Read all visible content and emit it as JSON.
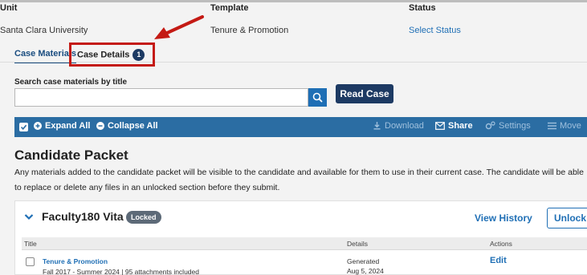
{
  "header": {
    "unit_label": "Unit",
    "unit_value": "Santa Clara University",
    "template_label": "Template",
    "template_value": "Tenure & Promotion",
    "status_label": "Status",
    "status_value": "Select Status"
  },
  "tabs": [
    {
      "label": "Case Materials"
    },
    {
      "label": "Case Details",
      "badge": "1"
    }
  ],
  "search": {
    "label": "Search case materials by title",
    "placeholder": "",
    "read_case_label": "Read Case"
  },
  "toolbar": {
    "expand_all": "Expand All",
    "collapse_all": "Collapse All",
    "download": "Download",
    "share": "Share",
    "settings": "Settings",
    "move": "Move"
  },
  "packet": {
    "title": "Candidate Packet",
    "description": "Any materials added to the candidate packet will be visible to the candidate and available for them to use in their current case. The candidate will be able to replace or delete any files in an unlocked section before they submit."
  },
  "section": {
    "title": "Faculty180 Vita",
    "locked_badge": "Locked",
    "view_history": "View History",
    "unlock": "Unlock",
    "columns": [
      "Title",
      "Details",
      "Actions"
    ],
    "rows": [
      {
        "title": "Tenure & Promotion",
        "subtitle": "Fall 2017 - Summer 2024 | 95 attachments included",
        "details_1": "Generated",
        "details_2": "Aug 5, 2024",
        "action": "Edit"
      }
    ]
  },
  "colors": {
    "accent_blue": "#1f6fb5",
    "navy": "#1d3a63",
    "toolbar_blue": "#2b6da3",
    "highlight_red": "#c41a14"
  }
}
